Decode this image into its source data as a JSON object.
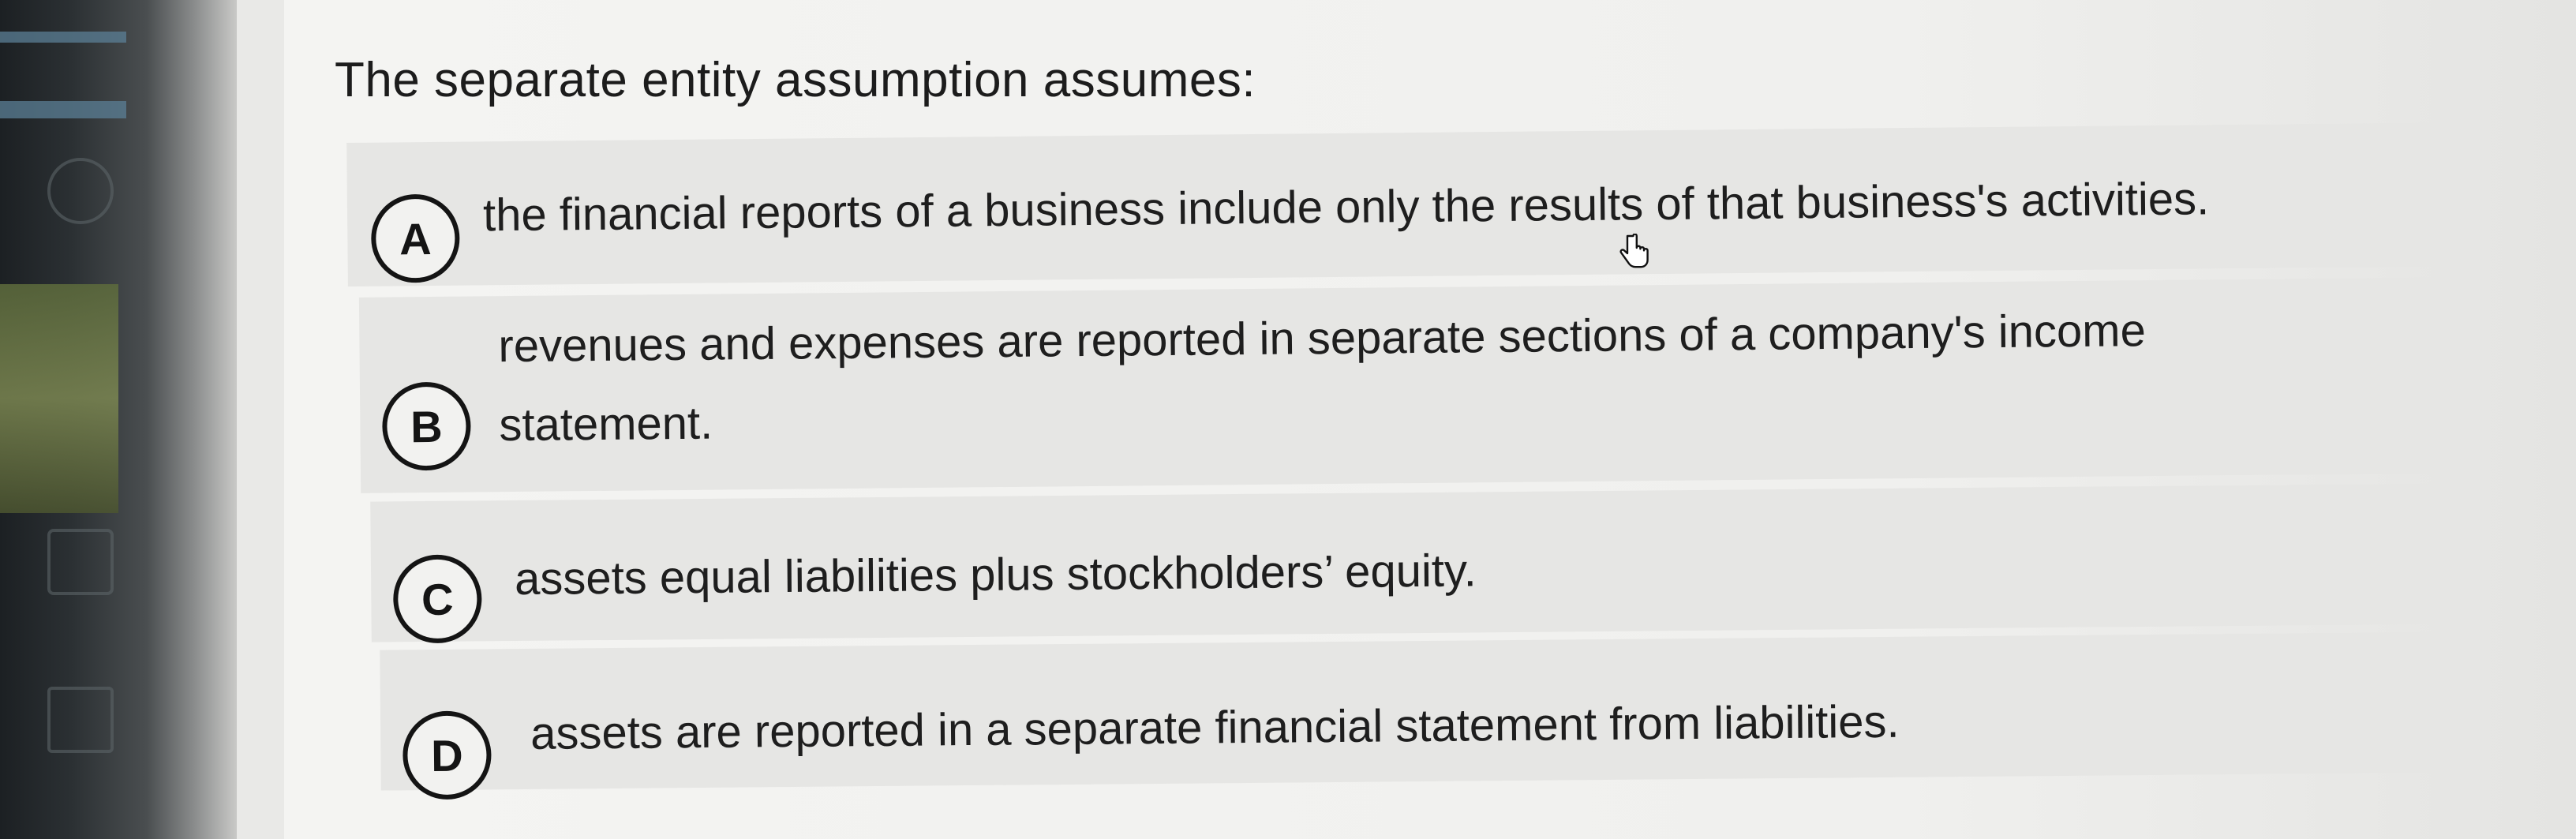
{
  "question": {
    "text": "The separate entity assumption assumes:"
  },
  "options": [
    {
      "letter": "A",
      "text": "the financial reports of a business include only the results of that business's activities."
    },
    {
      "letter": "B",
      "text": "revenues and expenses are reported in separate sections of a company's income statement."
    },
    {
      "letter": "C",
      "text": "assets equal liabilities plus stockholders’ equity."
    },
    {
      "letter": "D",
      "text": "assets are reported in a separate financial statement from liabilities."
    }
  ],
  "cursor": {
    "icon": "hand-pointer-icon"
  },
  "colors": {
    "background": "#f0f0ee",
    "option_bg": "#e6e6e4",
    "text": "#1e1e1e"
  }
}
